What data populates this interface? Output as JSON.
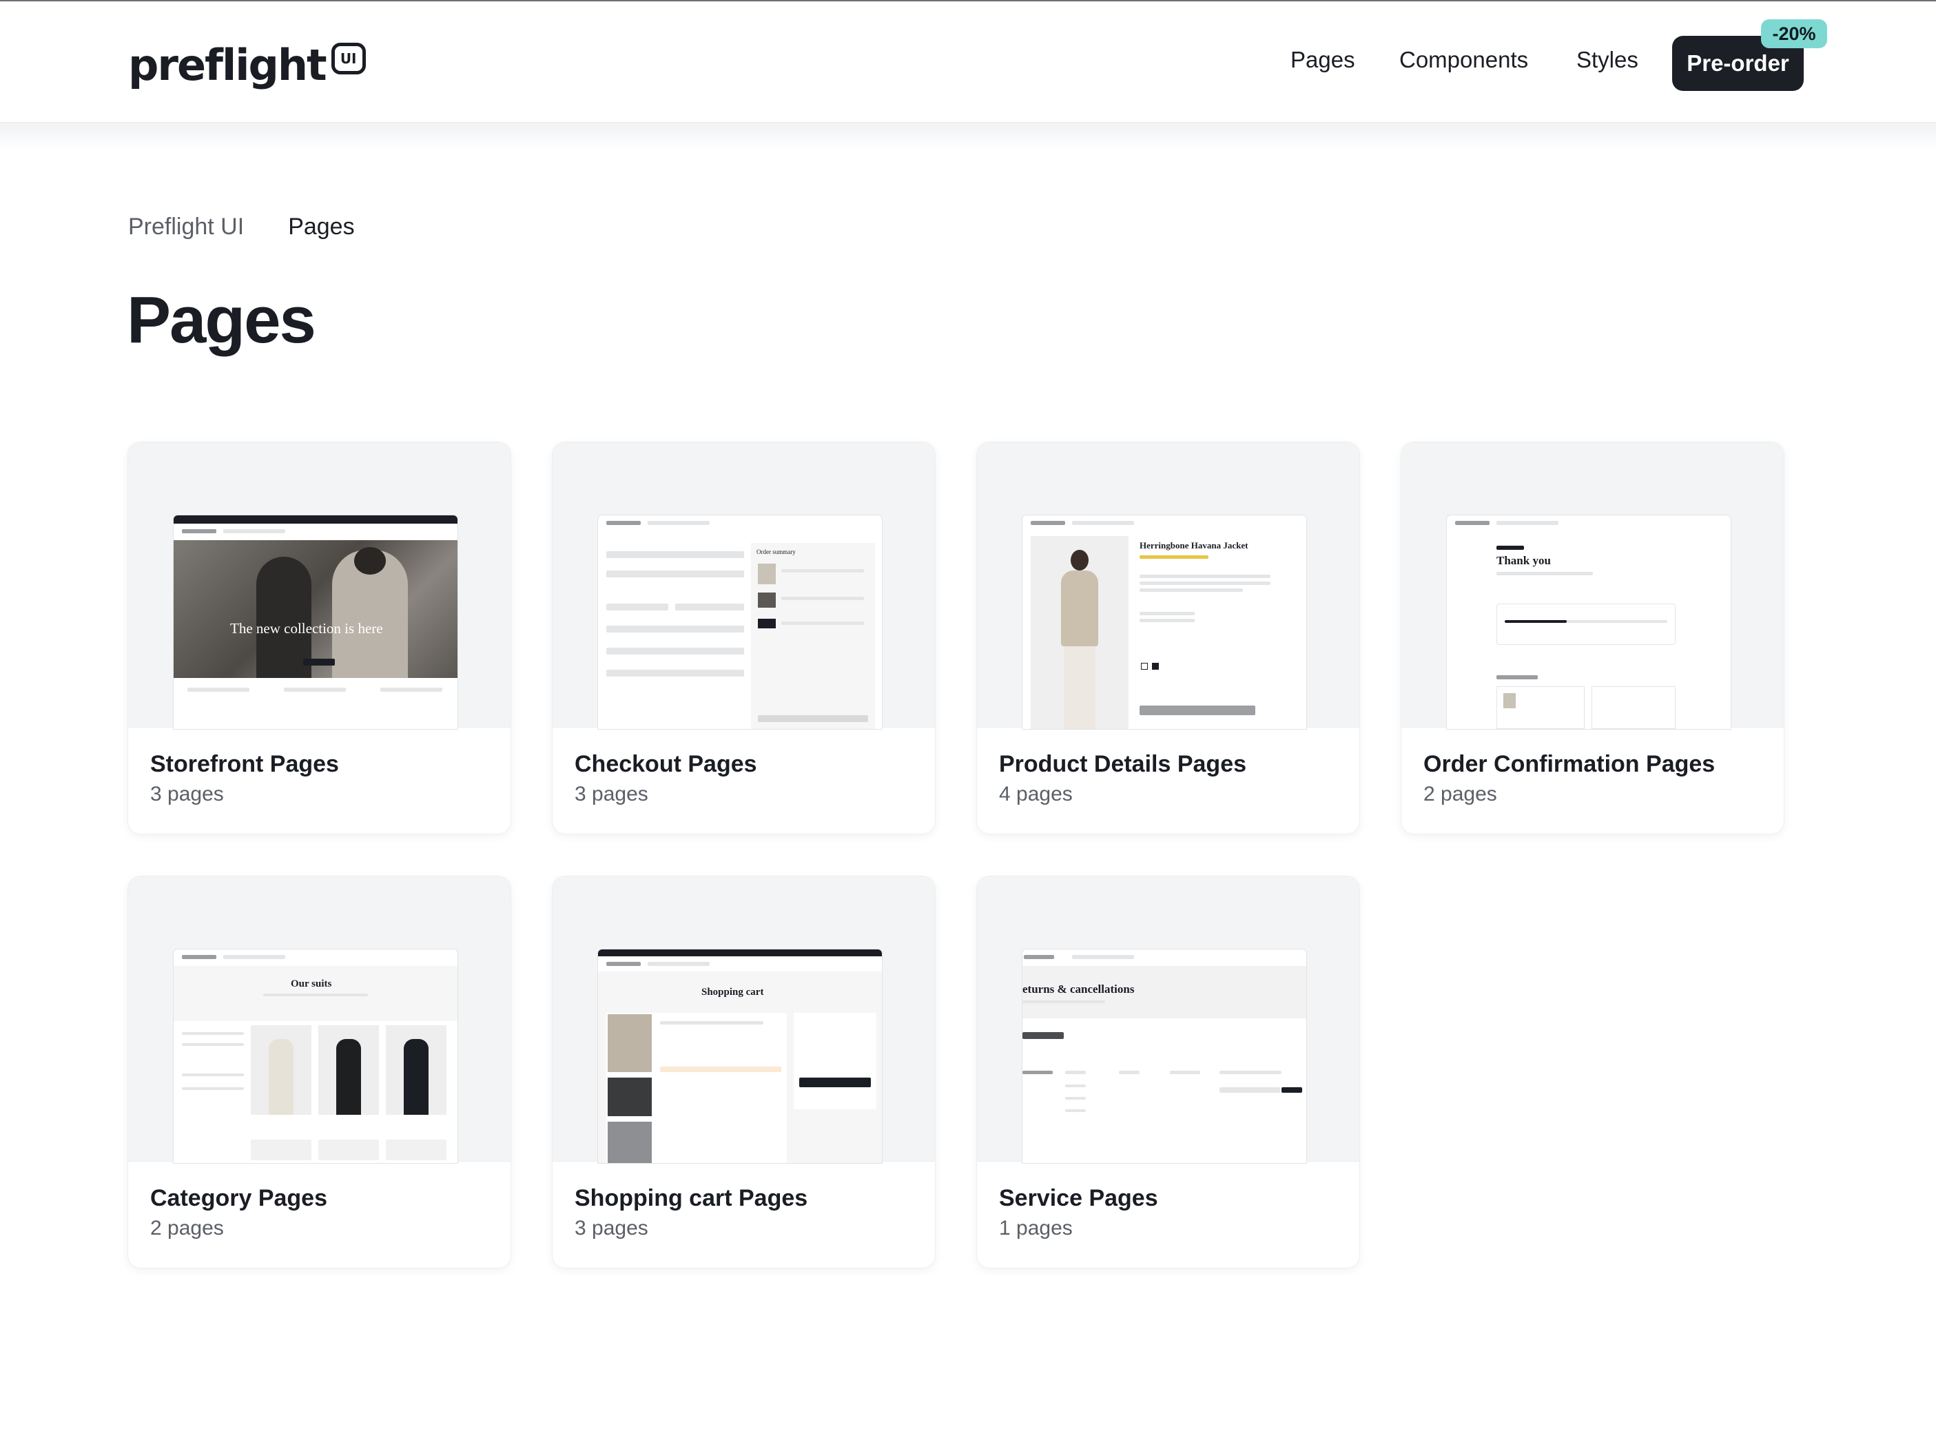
{
  "header": {
    "logo_text": "preflight",
    "logo_badge": "UI",
    "nav": [
      "Pages",
      "Components",
      "Styles"
    ],
    "preorder_label": "Pre-order",
    "discount_badge": "-20%"
  },
  "breadcrumb": [
    "Preflight UI",
    "Pages"
  ],
  "page_title": "Pages",
  "cards": [
    {
      "title": "Storefront Pages",
      "count": "3 pages",
      "preview_text": "The new collection is here"
    },
    {
      "title": "Checkout Pages",
      "count": "3 pages",
      "preview_text": "Order summary"
    },
    {
      "title": "Product Details Pages",
      "count": "4 pages",
      "preview_text": "Herringbone Havana Jacket"
    },
    {
      "title": "Order Confirmation Pages",
      "count": "2 pages",
      "preview_text": "Thank you"
    },
    {
      "title": "Category Pages",
      "count": "2 pages",
      "preview_text": "Our suits"
    },
    {
      "title": "Shopping cart Pages",
      "count": "3 pages",
      "preview_text": "Shopping cart"
    },
    {
      "title": "Service Pages",
      "count": "1 pages",
      "preview_text": "eturns & cancellations"
    }
  ],
  "colors": {
    "accent_badge": "#7dd8d2",
    "dark_button": "#1c1f26"
  }
}
